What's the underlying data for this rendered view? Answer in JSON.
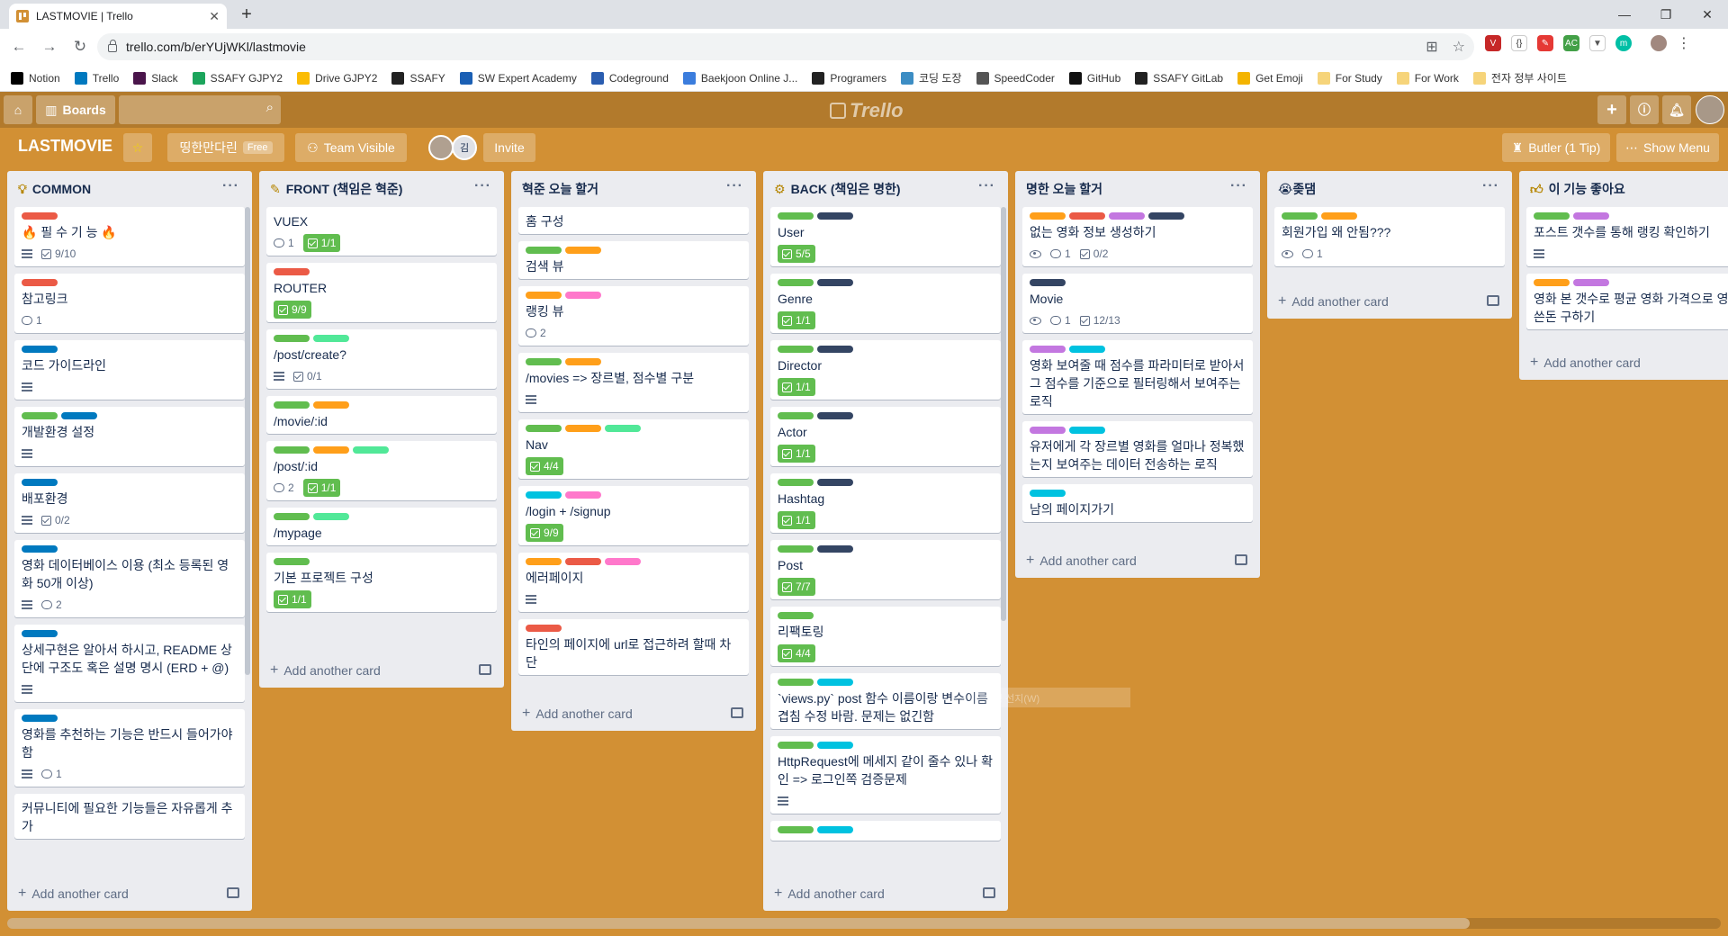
{
  "browser": {
    "tab_title": "LASTMOVIE | Trello",
    "url": "trello.com/b/erYUjWKl/lastmovie",
    "bookmarks": [
      {
        "label": "Notion",
        "color": "#000000"
      },
      {
        "label": "Trello",
        "color": "#0079bf"
      },
      {
        "label": "Slack",
        "color": "#4a154b"
      },
      {
        "label": "SSAFY GJPY2",
        "color": "#1ca55c"
      },
      {
        "label": "Drive GJPY2",
        "color": "#fbbc04"
      },
      {
        "label": "SSAFY",
        "color": "#222222"
      },
      {
        "label": "SW Expert Academy",
        "color": "#1a5fb4"
      },
      {
        "label": "Codeground",
        "color": "#2a5db0"
      },
      {
        "label": "Baekjoon Online J...",
        "color": "#3b7ddd"
      },
      {
        "label": "Programers",
        "color": "#222222"
      },
      {
        "label": "코딩 도장",
        "color": "#3c8dc4"
      },
      {
        "label": "SpeedCoder",
        "color": "#555555"
      },
      {
        "label": "GitHub",
        "color": "#111111"
      },
      {
        "label": "SSAFY GitLab",
        "color": "#222222"
      },
      {
        "label": "Get Emoji",
        "color": "#f4b400"
      },
      {
        "label": "For Study",
        "color": "#f6d47a"
      },
      {
        "label": "For Work",
        "color": "#f6d47a"
      },
      {
        "label": "전자 정부 사이트",
        "color": "#f6d47a"
      }
    ]
  },
  "header": {
    "boards_label": "Boards",
    "logo_text": "Trello"
  },
  "board": {
    "title": "LASTMOVIE",
    "team_name": "띵한만다린",
    "plan": "Free",
    "visibility": "Team Visible",
    "member_initial": "김",
    "invite_label": "Invite",
    "butler_label": "Butler (1 Tip)",
    "menu_label": "Show Menu",
    "add_card_label": "Add another card",
    "ghost_text": "명 선지(W)"
  },
  "colors": {
    "green": "#61bd4f",
    "red": "#eb5a46",
    "blue": "#0079bf",
    "orange": "#ff9f1a",
    "navy": "#344563",
    "purple": "#c377e0",
    "pink": "#ff78cb",
    "lime": "#51e898",
    "sky": "#00c2e0"
  },
  "lists": [
    {
      "icon": "bulb-icon",
      "title": "COMMON",
      "cards": [
        {
          "labels": [
            "red"
          ],
          "title": "🔥 필 수 기 능 🔥",
          "badges": {
            "desc": true,
            "checklist": "9/10"
          }
        },
        {
          "labels": [
            "red"
          ],
          "title": "참고링크",
          "badges": {
            "comments": "1"
          }
        },
        {
          "labels": [
            "blue"
          ],
          "title": "코드 가이드라인",
          "badges": {
            "desc": true
          }
        },
        {
          "labels": [
            "green",
            "blue"
          ],
          "title": "개발환경 설정",
          "badges": {
            "desc": true
          }
        },
        {
          "labels": [
            "blue"
          ],
          "title": "배포환경",
          "badges": {
            "desc": true,
            "checklist": "0/2"
          }
        },
        {
          "labels": [
            "blue"
          ],
          "title": "영화 데이터베이스 이용 (최소 등록된 영화 50개 이상)",
          "badges": {
            "desc": true,
            "comments": "2"
          }
        },
        {
          "labels": [
            "blue"
          ],
          "title": "상세구현은 알아서 하시고, README 상단에 구조도 혹은 설명 명시 (ERD + @)",
          "badges": {
            "desc": true
          }
        },
        {
          "labels": [
            "blue"
          ],
          "title": "영화를 추천하는 기능은 반드시 들어가야 함",
          "badges": {
            "desc": true,
            "comments": "1"
          }
        },
        {
          "labels": [],
          "title": "커뮤니티에 필요한 기능들은 자유롭게 추가",
          "badges": {}
        }
      ]
    },
    {
      "icon": "pencil-icon",
      "title": "FRONT (책임은 혁준)",
      "cards": [
        {
          "labels": [],
          "title": "VUEX",
          "badges": {
            "comments": "1",
            "checklist_done": "1/1"
          }
        },
        {
          "labels": [
            "red"
          ],
          "title": "ROUTER",
          "badges": {
            "checklist_done": "9/9"
          }
        },
        {
          "labels": [
            "green",
            "lime"
          ],
          "title": "/post/create?",
          "badges": {
            "desc": true,
            "checklist": "0/1"
          }
        },
        {
          "labels": [
            "green",
            "orange"
          ],
          "title": "/movie/:id",
          "badges": {}
        },
        {
          "labels": [
            "green",
            "orange",
            "lime"
          ],
          "title": "/post/:id",
          "badges": {
            "comments": "2",
            "checklist_done": "1/1"
          }
        },
        {
          "labels": [
            "green",
            "lime"
          ],
          "title": "/mypage",
          "badges": {}
        },
        {
          "labels": [
            "green"
          ],
          "title": "기본 프로젝트 구성",
          "badges": {
            "checklist_done": "1/1"
          }
        }
      ]
    },
    {
      "icon": "",
      "title": "혁준 오늘 할거",
      "cards": [
        {
          "labels": [],
          "title": "홈 구성",
          "badges": {}
        },
        {
          "labels": [
            "green",
            "orange"
          ],
          "title": "검색 뷰",
          "badges": {}
        },
        {
          "labels": [
            "orange",
            "pink"
          ],
          "title": "랭킹 뷰",
          "badges": {
            "comments": "2"
          }
        },
        {
          "labels": [
            "green",
            "orange"
          ],
          "title": "/movies => 장르별, 점수별 구분",
          "badges": {
            "desc": true
          }
        },
        {
          "labels": [
            "green",
            "orange",
            "lime"
          ],
          "title": "Nav",
          "badges": {
            "checklist_done": "4/4"
          }
        },
        {
          "labels": [
            "sky",
            "pink"
          ],
          "title": "/login + /signup",
          "badges": {
            "checklist_done": "9/9"
          }
        },
        {
          "labels": [
            "orange",
            "red",
            "pink"
          ],
          "title": "에러페이지",
          "badges": {
            "desc": true
          }
        },
        {
          "labels": [
            "red"
          ],
          "title": "타인의 페이지에 url로 접근하려 할때 차단",
          "badges": {}
        }
      ]
    },
    {
      "icon": "gear-icon",
      "title": "BACK (책임은 명한)",
      "cards": [
        {
          "labels": [
            "green",
            "navy"
          ],
          "title": "User",
          "badges": {
            "checklist_done": "5/5"
          }
        },
        {
          "labels": [
            "green",
            "navy"
          ],
          "title": "Genre",
          "badges": {
            "checklist_done": "1/1"
          }
        },
        {
          "labels": [
            "green",
            "navy"
          ],
          "title": "Director",
          "badges": {
            "checklist_done": "1/1"
          }
        },
        {
          "labels": [
            "green",
            "navy"
          ],
          "title": "Actor",
          "badges": {
            "checklist_done": "1/1"
          }
        },
        {
          "labels": [
            "green",
            "navy"
          ],
          "title": "Hashtag",
          "badges": {
            "checklist_done": "1/1"
          }
        },
        {
          "labels": [
            "green",
            "navy"
          ],
          "title": "Post",
          "badges": {
            "checklist_done": "7/7"
          }
        },
        {
          "labels": [
            "green"
          ],
          "title": "리팩토링",
          "badges": {
            "checklist_done": "4/4"
          }
        },
        {
          "labels": [
            "green",
            "sky"
          ],
          "title": "`views.py` post 함수 이름이랑 변수이름 겹침 수정 바람. 문제는 없긴함",
          "badges": {}
        },
        {
          "labels": [
            "green",
            "sky"
          ],
          "title": "HttpRequest에 메세지 같이 줄수 있나 확인 => 로그인쪽 검증문제",
          "badges": {
            "desc": true
          }
        },
        {
          "labels": [
            "green",
            "sky"
          ],
          "title": "",
          "badges": {}
        }
      ]
    },
    {
      "icon": "",
      "title": "명한 오늘 할거",
      "cards": [
        {
          "labels": [
            "orange",
            "red",
            "purple",
            "navy"
          ],
          "title": "없는 영화 정보 생성하기",
          "badges": {
            "watch": true,
            "comments": "1",
            "checklist": "0/2"
          }
        },
        {
          "labels": [
            "navy"
          ],
          "title": "Movie",
          "badges": {
            "watch": true,
            "comments": "1",
            "checklist": "12/13"
          }
        },
        {
          "labels": [
            "purple",
            "sky"
          ],
          "title": "영화 보여줄 때 점수를 파라미터로 받아서 그 점수를 기준으로 필터링해서 보여주는 로직",
          "badges": {}
        },
        {
          "labels": [
            "purple",
            "sky"
          ],
          "title": "유저에게 각 장르별 영화를 얼마나 정복했는지 보여주는 데이터 전송하는 로직",
          "badges": {}
        },
        {
          "labels": [
            "sky"
          ],
          "title": "남의 페이지가기",
          "badges": {}
        }
      ]
    },
    {
      "icon": "",
      "title": "😭좆댐",
      "cards": [
        {
          "labels": [
            "green",
            "orange"
          ],
          "title": "회원가입 왜 안됨???",
          "badges": {
            "watch": true,
            "comments": "1"
          }
        }
      ]
    },
    {
      "icon": "thumbs-up-icon",
      "title": "이 기능 좋아요",
      "cards": [
        {
          "labels": [
            "green",
            "purple"
          ],
          "title": "포스트 갯수를 통해 랭킹 확인하기",
          "badges": {
            "desc": true
          }
        },
        {
          "labels": [
            "orange",
            "purple"
          ],
          "title": "영화 본 갯수로 평균 영화 가격으로 영화 쓴돈 구하기",
          "badges": {}
        }
      ]
    }
  ]
}
